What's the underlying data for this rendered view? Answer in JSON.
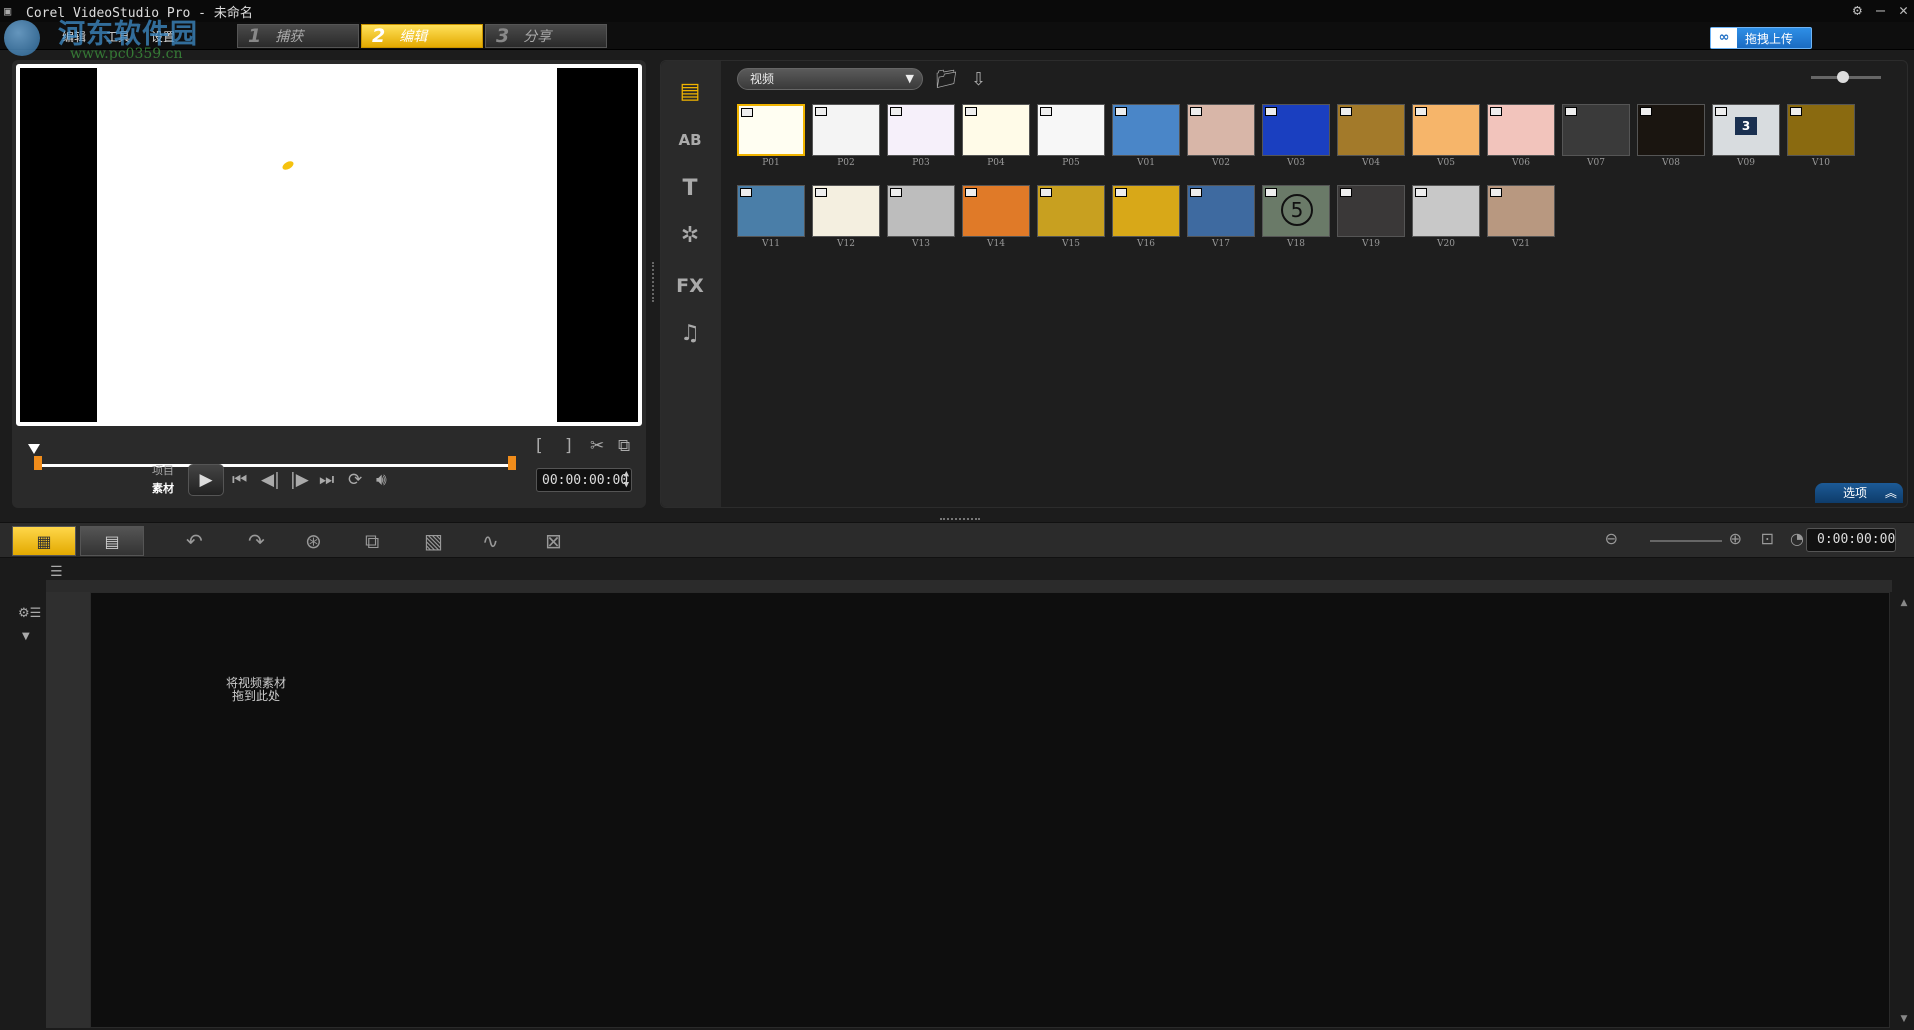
{
  "window": {
    "title": "Corel VideoStudio Pro - 未命名",
    "controls": [
      "⚙",
      "—",
      "✕"
    ]
  },
  "watermark": {
    "text": "河东软件园",
    "url": "www.pc0359.cn"
  },
  "menu": {
    "items": [
      "编辑",
      "工具",
      "设置"
    ]
  },
  "steps": [
    {
      "num": "1",
      "label": "捕获",
      "active": false
    },
    {
      "num": "2",
      "label": "编辑",
      "active": true
    },
    {
      "num": "3",
      "label": "分享",
      "active": false
    }
  ],
  "upload": {
    "label": "拖拽上传"
  },
  "preview": {
    "mode_project": "项目",
    "mode_clip": "素材",
    "timecode": "00:00:00:00",
    "mark_in": "[",
    "mark_out": "]"
  },
  "library": {
    "category": "视频",
    "tabs": [
      "media-icon",
      "transition-icon",
      "title-icon",
      "graphic-icon",
      "filter-icon",
      "audio-icon"
    ],
    "options_label": "选项",
    "thumbnails": [
      {
        "label": "P01",
        "bg": "#fffef2"
      },
      {
        "label": "P02",
        "bg": "#f4f4f4"
      },
      {
        "label": "P03",
        "bg": "#f6f0fa"
      },
      {
        "label": "P04",
        "bg": "#fffbe8"
      },
      {
        "label": "P05",
        "bg": "#f7f7f7"
      },
      {
        "label": "V01",
        "bg": "#4a86c8"
      },
      {
        "label": "V02",
        "bg": "#d8b6a8"
      },
      {
        "label": "V03",
        "bg": "#1a3fc0"
      },
      {
        "label": "V04",
        "bg": "#a37a2a"
      },
      {
        "label": "V05",
        "bg": "#f6b56a"
      },
      {
        "label": "V06",
        "bg": "#f2c4bc"
      },
      {
        "label": "V07",
        "bg": "#3a3a3a"
      },
      {
        "label": "V08",
        "bg": "#1a1510"
      },
      {
        "label": "V09",
        "bg": "#d8dcdf"
      },
      {
        "label": "V10",
        "bg": "#8a6a10"
      },
      {
        "label": "V11",
        "bg": "#4a7ea8"
      },
      {
        "label": "V12",
        "bg": "#f4efe0"
      },
      {
        "label": "V13",
        "bg": "#bdbdbd"
      },
      {
        "label": "V14",
        "bg": "#e07a28"
      },
      {
        "label": "V15",
        "bg": "#c8a020"
      },
      {
        "label": "V16",
        "bg": "#d8a818"
      },
      {
        "label": "V17",
        "bg": "#3e6aa0"
      },
      {
        "label": "V18",
        "bg": "#6a7a68"
      },
      {
        "label": "V19",
        "bg": "#3a3838"
      },
      {
        "label": "V20",
        "bg": "#c8c8c8"
      },
      {
        "label": "V21",
        "bg": "#b89880"
      }
    ],
    "v09_text": "3",
    "v18_text": "5"
  },
  "timeline": {
    "timecode": "0:00:00:00",
    "drop_hint": "将视频素材拖到此处"
  },
  "colors": {
    "accent": "#e3a900",
    "upload_blue": "#1b6bc2",
    "mark": "#f08c1b"
  }
}
